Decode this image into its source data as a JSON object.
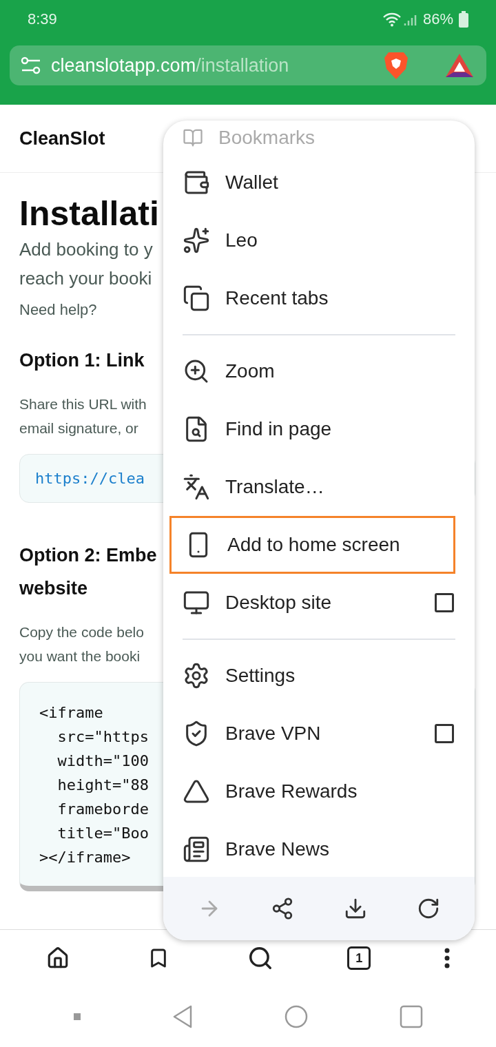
{
  "status_bar": {
    "time": "8:39",
    "battery": "86%"
  },
  "address_bar": {
    "host": "cleanslotapp.com",
    "path": "/installation"
  },
  "page": {
    "site_title": "CleanSlot",
    "heading": "Installati",
    "intro": [
      "Add booking to y",
      "reach your booki"
    ],
    "help": "Need help?",
    "option1": {
      "heading": "Option 1: Link",
      "text": [
        "Share this URL with",
        "email signature, or"
      ],
      "code": "https://clea"
    },
    "option2": {
      "heading": [
        "Option 2: Embe",
        "website"
      ],
      "text": [
        "Copy the code belo",
        "you want the booki"
      ],
      "code": [
        "<iframe",
        "  src=\"https",
        "  width=\"100",
        "  height=\"88",
        "  frameborde",
        "  title=\"Boo",
        "></iframe>"
      ]
    }
  },
  "menu": {
    "items": [
      {
        "kind": "item",
        "label": "Bookmarks",
        "highlighted": false
      },
      {
        "kind": "item",
        "label": "Wallet",
        "highlighted": false
      },
      {
        "kind": "item",
        "label": "Leo",
        "highlighted": false
      },
      {
        "kind": "item",
        "label": "Recent tabs",
        "highlighted": false
      },
      {
        "kind": "divider"
      },
      {
        "kind": "item",
        "label": "Zoom",
        "highlighted": false
      },
      {
        "kind": "item",
        "label": "Find in page",
        "highlighted": false
      },
      {
        "kind": "item",
        "label": "Translate…",
        "highlighted": false
      },
      {
        "kind": "item",
        "label": "Add to home screen",
        "highlighted": true
      },
      {
        "kind": "checkbox",
        "label": "Desktop site",
        "highlighted": false,
        "checked": false
      },
      {
        "kind": "divider"
      },
      {
        "kind": "item",
        "label": "Settings",
        "highlighted": false
      },
      {
        "kind": "checkbox",
        "label": "Brave VPN",
        "highlighted": false,
        "checked": false
      },
      {
        "kind": "item",
        "label": "Brave Rewards",
        "highlighted": false
      },
      {
        "kind": "item",
        "label": "Brave News",
        "highlighted": false
      }
    ],
    "toolbar": [
      {
        "disabled": true
      },
      {
        "disabled": false
      },
      {
        "disabled": false
      },
      {
        "disabled": false
      }
    ]
  },
  "bottom_nav": {
    "tab_count": "1"
  }
}
